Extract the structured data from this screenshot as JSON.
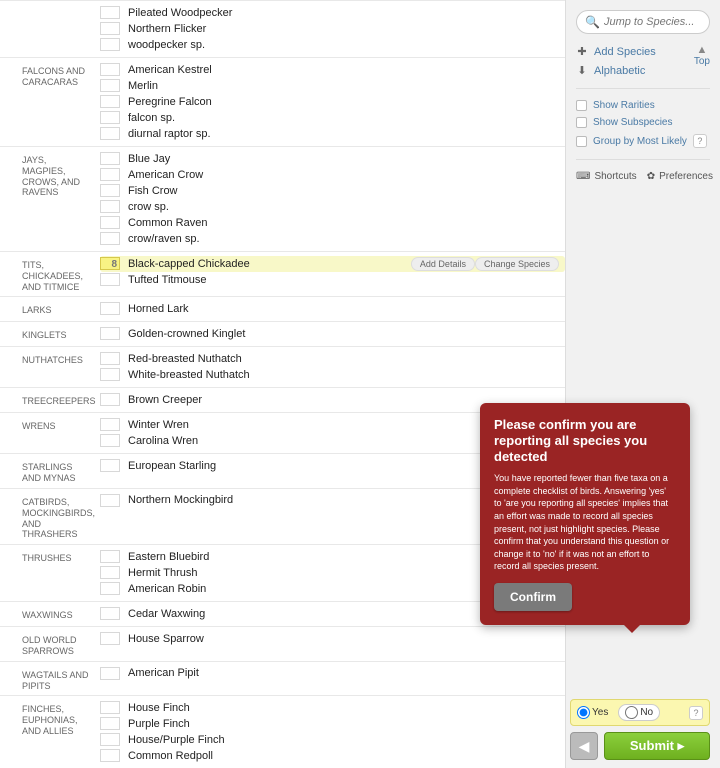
{
  "groups": [
    {
      "label": "",
      "idx": 0,
      "species": [
        {
          "name": "Pileated Woodpecker"
        },
        {
          "name": "Northern Flicker"
        },
        {
          "name": "woodpecker sp."
        }
      ]
    },
    {
      "label": "FALCONS AND CARACARAS",
      "idx": 1,
      "species": [
        {
          "name": "American Kestrel"
        },
        {
          "name": "Merlin"
        },
        {
          "name": "Peregrine Falcon"
        },
        {
          "name": "falcon sp."
        },
        {
          "name": "diurnal raptor sp."
        }
      ]
    },
    {
      "label": "JAYS, MAGPIES, CROWS, AND RAVENS",
      "idx": 2,
      "species": [
        {
          "name": "Blue Jay"
        },
        {
          "name": "American Crow"
        },
        {
          "name": "Fish Crow"
        },
        {
          "name": "crow sp."
        },
        {
          "name": "Common Raven"
        },
        {
          "name": "crow/raven sp."
        }
      ]
    },
    {
      "label": "TITS, CHICKADEES, AND TITMICE",
      "idx": 3,
      "species": [
        {
          "name": "Black-capped Chickadee",
          "count": "8",
          "selected": true,
          "add_details": "Add Details",
          "change": "Change Species"
        },
        {
          "name": "Tufted Titmouse"
        }
      ]
    },
    {
      "label": "LARKS",
      "idx": 4,
      "species": [
        {
          "name": "Horned Lark"
        }
      ]
    },
    {
      "label": "KINGLETS",
      "idx": 5,
      "species": [
        {
          "name": "Golden-crowned Kinglet"
        }
      ]
    },
    {
      "label": "NUTHATCHES",
      "idx": 6,
      "species": [
        {
          "name": "Red-breasted Nuthatch"
        },
        {
          "name": "White-breasted Nuthatch"
        }
      ]
    },
    {
      "label": "TREECREEPERS",
      "idx": 7,
      "species": [
        {
          "name": "Brown Creeper"
        }
      ]
    },
    {
      "label": "WRENS",
      "idx": 8,
      "species": [
        {
          "name": "Winter Wren"
        },
        {
          "name": "Carolina Wren"
        }
      ]
    },
    {
      "label": "STARLINGS AND MYNAS",
      "idx": 9,
      "species": [
        {
          "name": "European Starling"
        }
      ]
    },
    {
      "label": "CATBIRDS, MOCKINGBIRDS, AND THRASHERS",
      "idx": 10,
      "species": [
        {
          "name": "Northern Mockingbird"
        }
      ]
    },
    {
      "label": "THRUSHES",
      "idx": 11,
      "species": [
        {
          "name": "Eastern Bluebird"
        },
        {
          "name": "Hermit Thrush"
        },
        {
          "name": "American Robin"
        }
      ]
    },
    {
      "label": "WAXWINGS",
      "idx": 12,
      "species": [
        {
          "name": "Cedar Waxwing"
        }
      ]
    },
    {
      "label": "OLD WORLD SPARROWS",
      "idx": 13,
      "species": [
        {
          "name": "House Sparrow"
        }
      ]
    },
    {
      "label": "WAGTAILS AND PIPITS",
      "idx": 14,
      "species": [
        {
          "name": "American Pipit"
        }
      ]
    },
    {
      "label": "FINCHES, EUPHONIAS, AND ALLIES",
      "idx": 15,
      "species": [
        {
          "name": "House Finch"
        },
        {
          "name": "Purple Finch"
        },
        {
          "name": "House/Purple Finch"
        },
        {
          "name": "Common Redpoll"
        }
      ]
    }
  ],
  "sidebar": {
    "search_placeholder": "Jump to Species...",
    "add": "Add Species",
    "alpha": "Alphabetic",
    "top": "Top",
    "rarities": "Show Rarities",
    "subspecies": "Show Subspecies",
    "group_likely": "Group by Most Likely",
    "shortcuts": "Shortcuts",
    "preferences": "Preferences"
  },
  "modal": {
    "title": "Please confirm you are reporting all species you detected",
    "body": "You have reported fewer than five taxa on a complete checklist of birds. Answering 'yes' to 'are you reporting all species' implies that an effort was made to record all species present, not just highlight species. Please confirm that you understand this question or change it to 'no' if it was not an effort to record all species present.",
    "confirm": "Confirm"
  },
  "bottom": {
    "yes": "Yes",
    "no": "No",
    "submit": "Submit"
  }
}
